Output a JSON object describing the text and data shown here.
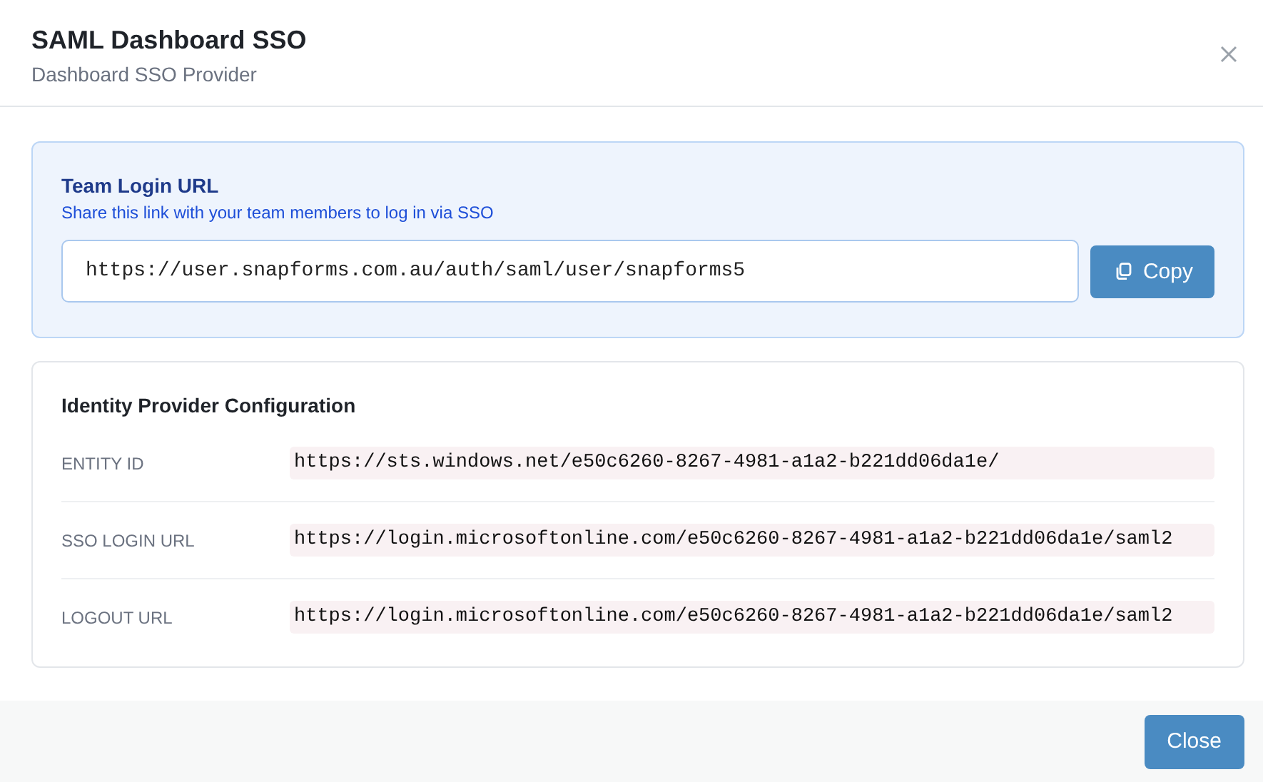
{
  "dialog": {
    "title": "SAML Dashboard SSO",
    "subtitle": "Dashboard SSO Provider"
  },
  "team_login": {
    "title": "Team Login URL",
    "hint": "Share this link with your team members to log in via SSO",
    "url": "https://user.snapforms.com.au/auth/saml/user/snapforms5",
    "copy_button": "Copy"
  },
  "identity_provider": {
    "title": "Identity Provider Configuration",
    "rows": [
      {
        "label": "ENTITY ID",
        "value": "https://sts.windows.net/e50c6260-8267-4981-a1a2-b221dd06da1e/"
      },
      {
        "label": "SSO LOGIN URL",
        "value": "https://login.microsoftonline.com/e50c6260-8267-4981-a1a2-b221dd06da1e/saml2"
      },
      {
        "label": "LOGOUT URL",
        "value": "https://login.microsoftonline.com/e50c6260-8267-4981-a1a2-b221dd06da1e/saml2"
      }
    ]
  },
  "footer": {
    "close_button": "Close"
  }
}
